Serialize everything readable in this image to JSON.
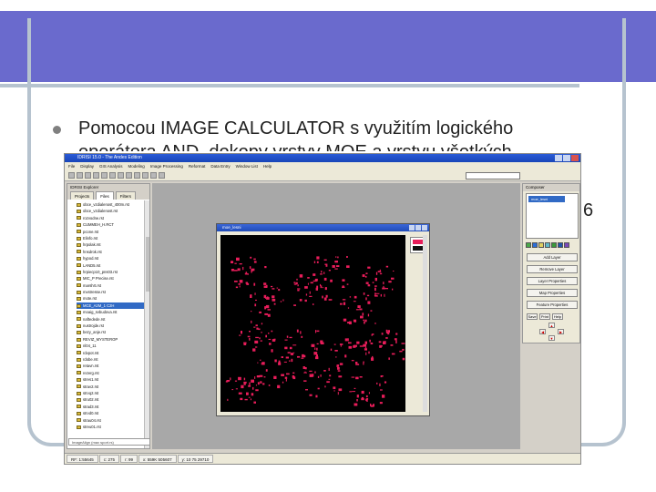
{
  "slide": {
    "bullet_line1": "Pomocou IMAGE CALCULATOR s využitím logického",
    "bullet_line2": "operátora AND, dokopy vrstvy MOE a vrstvu všetkých",
    "side_digit": "6"
  },
  "app": {
    "title": "IDRISI 15.0 - The Andes Edition",
    "menu": [
      "File",
      "Display",
      "GIS Analysis",
      "Modeling",
      "Image Processing",
      "Reformat",
      "Data Entry",
      "Window List",
      "Help"
    ],
    "explorer": {
      "title": "IDRISI Explorer",
      "tabs": [
        "Projects",
        "Files",
        "Filters"
      ],
      "active_tab": "Files",
      "files": [
        "obce_vzdialenost_400m.rst",
        "obce_vzdialenost.rst",
        "rozvodne.rst",
        "CUMMEH_H.RCT",
        "pcone.rst",
        "Elinfo.rst",
        "hrpolak.rst",
        "hnsdrok.rst",
        "hypod.rst",
        "LAND5.rst",
        "hrpiecp10_pns03.rst",
        "MIC_P Precise.rst",
        "marshrt.rst",
        "mxstresse.rst",
        "mote.rst",
        "MCE_A2M_1 C2H",
        "moaig_svbudova.rst",
        "naftedede.rst",
        "nustrojde.rst",
        "bezy_anje.rst",
        "REVIZ_MYSTEROP",
        "nl04_11",
        "rdvpot.rst",
        "rdobe.rst",
        "retavn.rst",
        "rezerg.rst",
        "stres1.rst",
        "strav2.rst",
        "strvq2.rst",
        "stru02.rst",
        "strad3.rst",
        "strvd0.rst",
        "strau04.rst",
        "streu01.rst"
      ],
      "selected_file": "MCE_A2M_1 C2H",
      "input_text": "ImageAlign (max sport.rs)"
    },
    "map_window": {
      "title": "moe_lesni",
      "legend_value": "1"
    },
    "composer": {
      "title": "Composer",
      "layer": "moe_lesni",
      "buttons": [
        "Add Layer",
        "Remove Layer",
        "Layer Properties",
        "Map Properties",
        "Feature Properties"
      ],
      "nav": [
        "Save",
        "Print",
        "Help"
      ]
    },
    "statusbar": [
      "RF: 1:55645",
      "c: 275",
      "r: 99",
      "x: 559K 505607",
      "y: 10 75 29710"
    ]
  },
  "colors": {
    "header": "#6a6acd",
    "frame": "#b6c3cf",
    "map_feature": "#e81d5a",
    "map_background": "#000000"
  }
}
